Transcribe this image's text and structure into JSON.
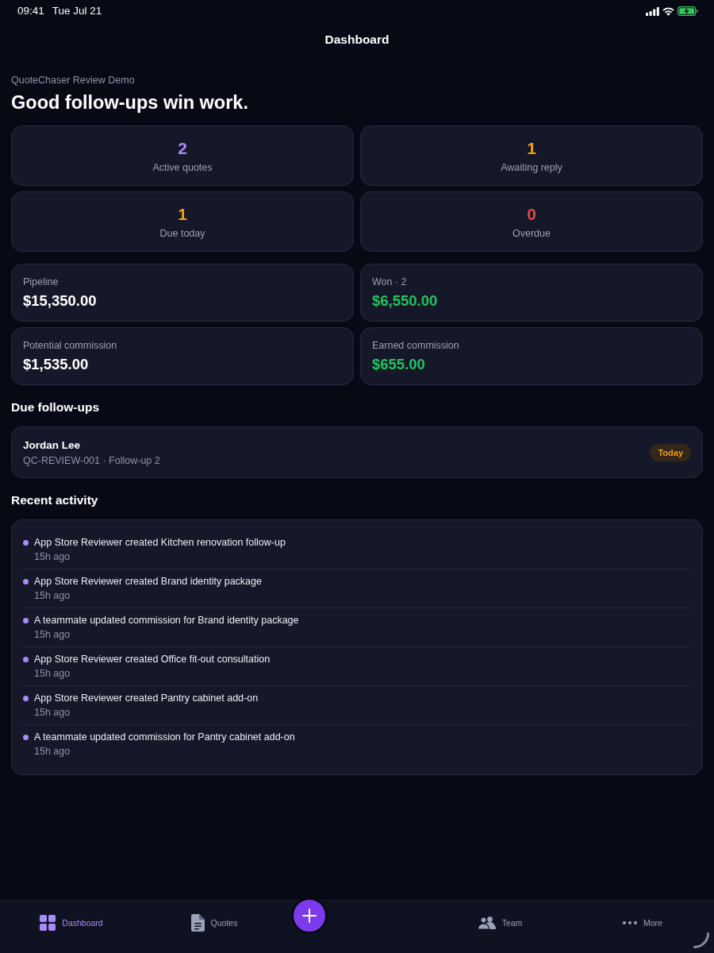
{
  "status_bar": {
    "time": "09:41",
    "date": "Tue Jul 21"
  },
  "nav_bar": {
    "title": "Dashboard"
  },
  "header": {
    "subtitle": "QuoteChaser Review Demo",
    "heading": "Good follow-ups win work."
  },
  "stats": [
    {
      "value": "2",
      "label": "Active quotes",
      "color": "#a78bfa"
    },
    {
      "value": "1",
      "label": "Awaiting reply",
      "color": "#f59e0b"
    },
    {
      "value": "1",
      "label": "Due today",
      "color": "#f59e0b"
    },
    {
      "value": "0",
      "label": "Overdue",
      "color": "#ef4444"
    }
  ],
  "totals": [
    {
      "label": "Pipeline",
      "value": "$15,350.00",
      "color": "#ffffff"
    },
    {
      "label": "Won · 2",
      "value": "$6,550.00",
      "color": "#22c55e"
    },
    {
      "label": "Potential commission",
      "value": "$1,535.00",
      "color": "#ffffff"
    },
    {
      "label": "Earned commission",
      "value": "$655.00",
      "color": "#22c55e"
    }
  ],
  "due_followups": {
    "title": "Due follow-ups",
    "items": [
      {
        "name": "Jordan Lee",
        "detail": "QC-REVIEW-001 · Follow-up 2",
        "badge": "Today"
      }
    ]
  },
  "recent_activity": {
    "title": "Recent activity",
    "items": [
      {
        "text": "App Store Reviewer created Kitchen renovation follow-up",
        "time": "15h ago"
      },
      {
        "text": "App Store Reviewer created Brand identity package",
        "time": "15h ago"
      },
      {
        "text": "A teammate updated commission for Brand identity package",
        "time": "15h ago"
      },
      {
        "text": "App Store Reviewer created Office fit-out consultation",
        "time": "15h ago"
      },
      {
        "text": "App Store Reviewer created Pantry cabinet add-on",
        "time": "15h ago"
      },
      {
        "text": "A teammate updated commission for Pantry cabinet add-on",
        "time": "15h ago"
      }
    ]
  },
  "tab_bar": {
    "tabs": [
      {
        "kind": "dashboard",
        "label": "Dashboard",
        "selected": true
      },
      {
        "kind": "quotes",
        "label": "Quotes",
        "selected": false
      },
      {
        "kind": "team",
        "label": "Team",
        "selected": false
      },
      {
        "kind": "more",
        "label": "More",
        "selected": false
      }
    ]
  }
}
